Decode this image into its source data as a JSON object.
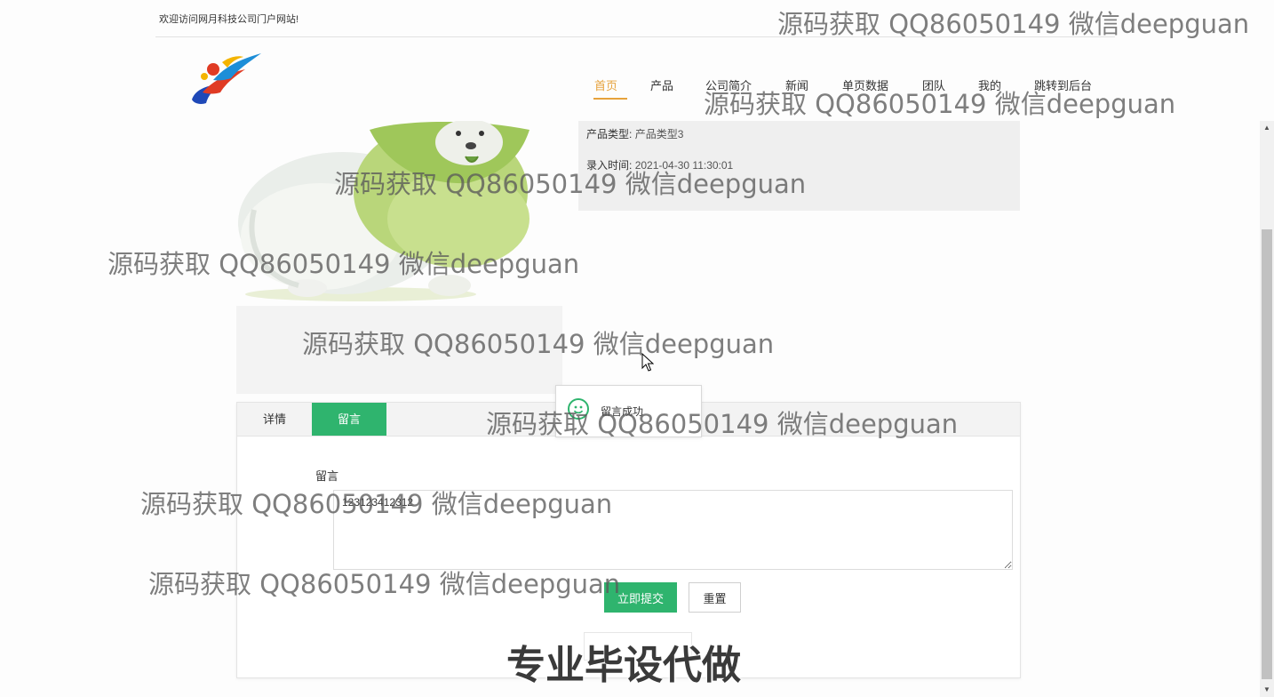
{
  "header": {
    "welcome": "欢迎访问网月科技公司门户网站!",
    "logo_icon": "company-logo"
  },
  "nav": {
    "items": [
      {
        "label": "首页",
        "active": true
      },
      {
        "label": "产品"
      },
      {
        "label": "公司简介"
      },
      {
        "label": "新闻"
      },
      {
        "label": "单页数据"
      },
      {
        "label": "团队"
      },
      {
        "label": "我的"
      },
      {
        "label": "跳转到后台"
      }
    ],
    "active_color": "#e6a23c"
  },
  "product": {
    "type_label": "产品类型:",
    "type_value": "产品类型3",
    "time_label": "录入时间:",
    "time_value": "2021-04-30 11:30:01"
  },
  "tabs": {
    "items": [
      {
        "label": "详情"
      },
      {
        "label": "留言",
        "active": true
      }
    ],
    "active_color": "#2fb46e"
  },
  "form": {
    "message_label": "留言",
    "message_value": "123123412312",
    "submit_label": "立即提交",
    "reset_label": "重置"
  },
  "toast": {
    "text": "留言成功",
    "icon": "success-smile-icon"
  },
  "watermark": "源码获取 QQ86050149 微信deepguan",
  "caption": "专业毕设代做"
}
